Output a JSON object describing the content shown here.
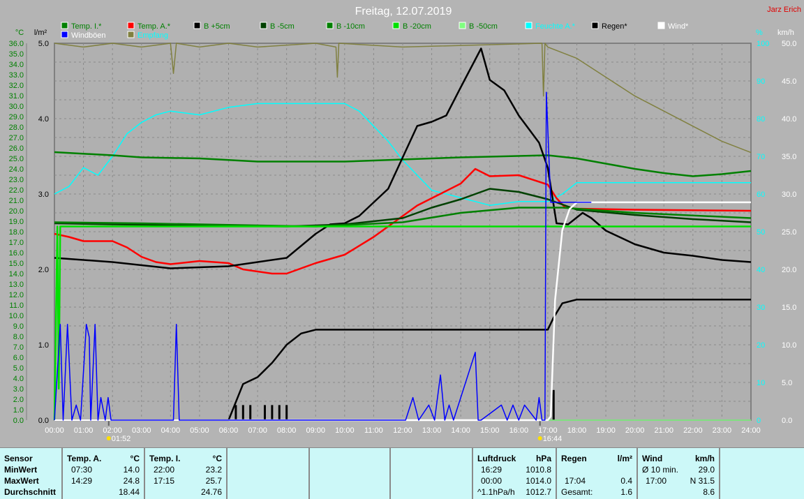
{
  "header": {
    "title": "Freitag, 12.07.2019",
    "author": "Jarz Erich"
  },
  "legend": [
    {
      "label": "Temp. I.*",
      "color": "#008000",
      "text_color": "#008000"
    },
    {
      "label": "Temp. A.*",
      "color": "#ff0000",
      "text_color": "#008000"
    },
    {
      "label": "B +5cm",
      "color": "#000000",
      "text_color": "#008000"
    },
    {
      "label": "B -5cm",
      "color": "#004000",
      "text_color": "#008000"
    },
    {
      "label": "B -10cm",
      "color": "#008000",
      "text_color": "#008000"
    },
    {
      "label": "B -20cm",
      "color": "#00e000",
      "text_color": "#008000"
    },
    {
      "label": "B -50cm",
      "color": "#80ff80",
      "text_color": "#008000"
    },
    {
      "label": "Feuchte A.*",
      "color": "#00ffff",
      "text_color": "#00ffff"
    },
    {
      "label": "Regen*",
      "color": "#000000",
      "text_color": "#000000"
    },
    {
      "label": "Wind*",
      "color": "#ffffff",
      "text_color": "#ffffff"
    },
    {
      "label": "Windböen",
      "color": "#0000ff",
      "text_color": "#ffffff"
    },
    {
      "label": "Empfang",
      "color": "#808040",
      "text_color": "#00ffff"
    }
  ],
  "chart_data": {
    "type": "line",
    "title": "Freitag, 12.07.2019",
    "x_unit": "hour",
    "xlim": [
      0,
      24
    ],
    "x_ticks": [
      "00:00",
      "01:00",
      "02:00",
      "03:00",
      "04:00",
      "05:00",
      "06:00",
      "07:00",
      "08:00",
      "09:00",
      "10:00",
      "11:00",
      "12:00",
      "13:00",
      "14:00",
      "15:00",
      "16:00",
      "17:00",
      "18:00",
      "19:00",
      "20:00",
      "21:00",
      "22:00",
      "23:00",
      "24:00"
    ],
    "axes": {
      "temp": {
        "label": "°C",
        "ylim": [
          0,
          36
        ],
        "ticks": [
          "0.0",
          "1.0",
          "2.0",
          "3.0",
          "4.0",
          "5.0",
          "6.0",
          "7.0",
          "8.0",
          "9.0",
          "10.0",
          "11.0",
          "12.0",
          "13.0",
          "14.0",
          "15.0",
          "16.0",
          "17.0",
          "18.0",
          "19.0",
          "20.0",
          "21.0",
          "22.0",
          "23.0",
          "24.0",
          "25.0",
          "26.0",
          "27.0",
          "28.0",
          "29.0",
          "30.0",
          "31.0",
          "32.0",
          "33.0",
          "34.0",
          "35.0",
          "36.0"
        ]
      },
      "rain": {
        "label": "l/m²",
        "ylim": [
          0,
          5
        ],
        "ticks": [
          "0.0",
          "1.0",
          "2.0",
          "3.0",
          "4.0",
          "5.0"
        ]
      },
      "humidity": {
        "label": "%",
        "ylim": [
          0,
          100
        ],
        "ticks": [
          "0",
          "10",
          "20",
          "30",
          "40",
          "50",
          "60",
          "70",
          "80",
          "90",
          "100"
        ]
      },
      "wind": {
        "label": "km/h",
        "ylim": [
          0,
          50
        ],
        "ticks": [
          "0.0",
          "5.0",
          "10.0",
          "15.0",
          "20.0",
          "25.0",
          "30.0",
          "35.0",
          "40.0",
          "45.0",
          "50.0"
        ]
      }
    },
    "markers": [
      {
        "time": "01:52",
        "hour": 1.87
      },
      {
        "time": "16:44",
        "hour": 16.73
      }
    ],
    "series": [
      {
        "name": "Empfang",
        "axis": "humidity",
        "color": "#808040",
        "x": [
          0,
          1,
          2,
          3,
          4,
          4.1,
          4.2,
          5,
          6,
          7,
          9,
          9.7,
          9.75,
          9.8,
          12,
          16.8,
          16.85,
          16.9,
          17,
          18,
          19,
          20,
          21,
          22,
          23,
          24
        ],
        "y": [
          100,
          99,
          100,
          99,
          100,
          92,
          100,
          99,
          100,
          99,
          100,
          99,
          91,
          100,
          99,
          100,
          86,
          100,
          99,
          96,
          91,
          86,
          82,
          78,
          74,
          71
        ]
      },
      {
        "name": "Feuchte A.*",
        "axis": "humidity",
        "color": "#00ffff",
        "x": [
          0,
          0.5,
          1,
          1.5,
          2,
          2.5,
          3,
          3.5,
          4,
          5,
          6,
          7,
          8,
          9,
          10,
          10.5,
          11,
          11.5,
          12,
          12.5,
          13,
          14,
          15,
          16,
          17,
          17.5,
          18,
          19,
          20,
          21,
          22,
          23,
          24
        ],
        "y": [
          60,
          62,
          67,
          65,
          70,
          76,
          79,
          81,
          82,
          81,
          83,
          84,
          84,
          84,
          84,
          82,
          78,
          74,
          69,
          65,
          61,
          59,
          57,
          58,
          58,
          60,
          63,
          63,
          63,
          63,
          63,
          63,
          63
        ]
      },
      {
        "name": "Temp. I.*",
        "axis": "temp",
        "color": "#008000",
        "x": [
          0,
          2,
          3,
          5,
          7,
          10,
          12,
          14,
          17,
          18,
          19,
          20,
          21,
          22,
          23,
          24
        ],
        "y": [
          25.6,
          25.3,
          25.1,
          25.0,
          24.7,
          24.7,
          24.9,
          25.1,
          25.3,
          25.0,
          24.5,
          24.0,
          23.6,
          23.3,
          23.5,
          23.8
        ]
      },
      {
        "name": "Temp. A.*",
        "axis": "temp",
        "color": "#ff0000",
        "x": [
          0,
          0.5,
          1,
          2,
          2.5,
          3,
          3.5,
          4,
          5,
          6,
          6.5,
          7.5,
          8,
          9,
          10,
          11,
          12,
          12.5,
          13,
          14,
          14.5,
          15,
          16,
          17,
          17.3,
          17.6,
          18,
          20,
          24
        ],
        "y": [
          17.8,
          17.5,
          17.1,
          17.1,
          16.5,
          15.6,
          15.1,
          14.9,
          15.2,
          15.0,
          14.4,
          14.0,
          14.0,
          15.0,
          15.8,
          17.5,
          19.5,
          20.5,
          21.2,
          22.6,
          24.0,
          23.3,
          23.4,
          22.5,
          21.2,
          20.3,
          20.2,
          20.1,
          20.0
        ]
      },
      {
        "name": "B +5cm",
        "axis": "temp",
        "color": "#000000",
        "x": [
          0,
          2,
          4,
          6,
          7,
          8,
          9,
          9.5,
          10,
          10.5,
          11,
          11.5,
          12,
          12.5,
          13,
          13.5,
          14,
          14.7,
          15,
          15.5,
          16,
          16.7,
          17,
          17.3,
          17.7,
          18.2,
          18.5,
          19,
          20,
          21,
          22,
          23,
          24
        ],
        "y": [
          15.5,
          15.1,
          14.5,
          14.7,
          15.1,
          15.5,
          17.8,
          18.7,
          18.8,
          19.5,
          20.8,
          22.1,
          25.1,
          28.1,
          28.5,
          29.1,
          31.8,
          35.5,
          32.5,
          31.5,
          29.1,
          26.5,
          24.1,
          18.8,
          18.7,
          19.8,
          19.3,
          18.1,
          16.8,
          16.0,
          15.7,
          15.3,
          15.1
        ]
      },
      {
        "name": "B -5cm",
        "axis": "temp",
        "color": "#004000",
        "x": [
          0,
          2,
          8,
          10,
          12,
          13,
          14,
          15,
          16,
          17,
          18,
          20,
          22,
          24
        ],
        "y": [
          18.8,
          18.7,
          18.5,
          18.7,
          19.3,
          20.3,
          21.1,
          22.1,
          21.8,
          21.1,
          20.1,
          19.6,
          19.2,
          18.9
        ]
      },
      {
        "name": "B -10cm",
        "axis": "temp",
        "color": "#008000",
        "x": [
          0,
          3,
          9,
          12,
          14,
          16,
          17.5,
          20,
          24
        ],
        "y": [
          18.9,
          18.8,
          18.5,
          18.9,
          19.8,
          20.3,
          20.3,
          19.8,
          19.3
        ]
      },
      {
        "name": "B -20cm",
        "axis": "temp",
        "color": "#00e000",
        "x": [
          0,
          0.1,
          0.15,
          0.2,
          24
        ],
        "y": [
          0,
          18.5,
          3,
          18.5,
          18.5
        ]
      },
      {
        "name": "B -50cm",
        "axis": "temp",
        "color": "#80ff80",
        "x": [
          0,
          24
        ],
        "y": [
          0,
          0
        ]
      },
      {
        "name": "Regen*",
        "axis": "rain",
        "color": "#000000",
        "x": [
          0,
          6,
          6.5,
          7,
          7.5,
          8,
          8.5,
          9,
          17,
          17.2,
          17.5,
          18,
          24
        ],
        "y": [
          0,
          0,
          0.48,
          0.57,
          0.76,
          1.0,
          1.15,
          1.2,
          1.2,
          1.36,
          1.55,
          1.6,
          1.6
        ]
      },
      {
        "name": "Wind*",
        "axis": "wind",
        "color": "#ffffff",
        "x": [
          0,
          17,
          17.1,
          17.25,
          17.5,
          17.75,
          18,
          24
        ],
        "y": [
          0,
          0,
          0.5,
          15.9,
          25.2,
          28,
          28.9,
          28.9
        ]
      },
      {
        "name": "Windböen",
        "axis": "wind",
        "color": "#0000ff",
        "x": [
          0,
          0.2,
          0.3,
          0.45,
          0.6,
          0.75,
          0.9,
          1.1,
          1.2,
          1.25,
          1.4,
          1.5,
          1.6,
          1.75,
          1.85,
          1.95,
          2.05,
          4.1,
          4.2,
          4.3,
          4.4,
          12.1,
          12.35,
          12.55,
          12.9,
          13.1,
          13.3,
          13.45,
          13.6,
          13.75,
          14.5,
          14.6,
          14.7,
          15.4,
          15.6,
          15.8,
          16.0,
          16.2,
          16.6,
          16.7,
          16.8,
          16.9,
          16.95,
          17.1,
          17.3,
          17.5,
          18.5
        ],
        "y": [
          0,
          12.7,
          0,
          12.7,
          0,
          2,
          0,
          12.7,
          11,
          0,
          12.7,
          0,
          3,
          0,
          3,
          0,
          0,
          0,
          12.7,
          0,
          0,
          0,
          3,
          0,
          2,
          0,
          6,
          0,
          2,
          0,
          9,
          0,
          0,
          2,
          0,
          2,
          0,
          2,
          0,
          3,
          0,
          0,
          43.5,
          28.9,
          28.9,
          28.9,
          28.9
        ]
      }
    ],
    "rain_bars": {
      "axis": "rain",
      "x": [
        6.25,
        6.5,
        6.75,
        7.25,
        7.5,
        7.75,
        8.0,
        17.2
      ],
      "y": [
        0.2,
        0.2,
        0.2,
        0.2,
        0.2,
        0.2,
        0.2,
        0.4
      ]
    }
  },
  "stats": {
    "row_labels": [
      "Sensor",
      "MinWert",
      "MaxWert",
      "Durchschnitt"
    ],
    "temp_a": {
      "title": "Temp. A.",
      "unit": "°C",
      "min_time": "07:30",
      "min": "14.0",
      "max_time": "14:29",
      "max": "24.8",
      "avg": "18.44"
    },
    "temp_i": {
      "title": "Temp. I.",
      "unit": "°C",
      "min_time": "22:00",
      "min": "23.2",
      "max_time": "17:15",
      "max": "25.7",
      "avg": "24.76"
    },
    "pressure": {
      "title": "Luftdruck",
      "unit": "hPa",
      "min_time": "16:29",
      "min": "1010.8",
      "max_time": "00:00",
      "max": "1014.0",
      "trend": "^1.1hPa/h",
      "avg": "1012.7"
    },
    "rain": {
      "title": "Regen",
      "unit": "l/m²",
      "max_time": "17:04",
      "max": "0.4",
      "total_label": "Gesamt:",
      "total": "1.6"
    },
    "wind": {
      "title": "Wind",
      "unit": "km/h",
      "avg10_label": "Ø 10 min.",
      "avg10": "29.0",
      "max_time": "17:00",
      "max": "N 31.5",
      "avg": "8.6"
    }
  }
}
